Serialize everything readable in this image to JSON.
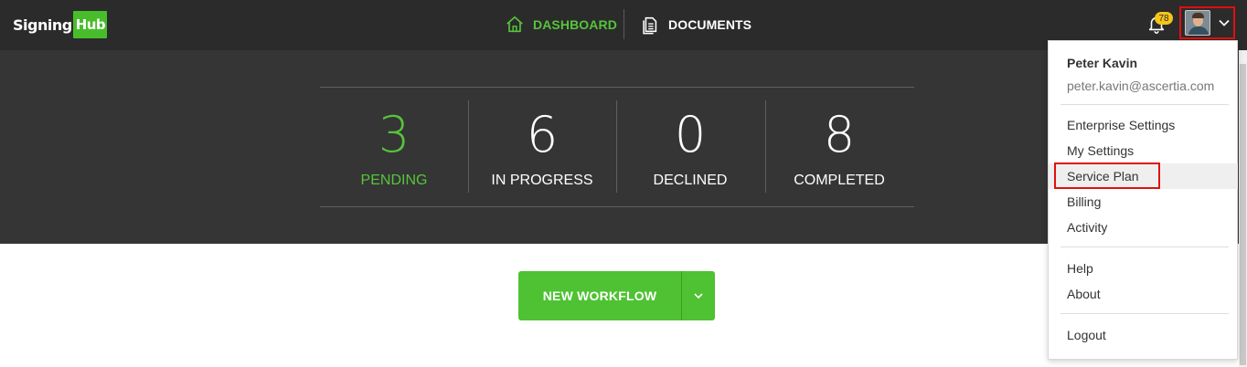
{
  "brand": {
    "logo_text": "Signing",
    "logo_box": "Hub"
  },
  "nav": {
    "dashboard": {
      "label": "DASHBOARD",
      "icon": "home-icon",
      "color": "#56c43a"
    },
    "documents": {
      "label": "DOCUMENTS",
      "icon": "documents-icon",
      "color": "#ffffff"
    }
  },
  "notifications": {
    "count": "78",
    "icon": "bell-icon"
  },
  "user": {
    "avatar_icon": "user-avatar",
    "menu_icon": "chevron-down-icon"
  },
  "stats": [
    {
      "value": "3",
      "label": "PENDING",
      "color": "#56c43a"
    },
    {
      "value": "6",
      "label": "IN PROGRESS",
      "color": "#ffffff"
    },
    {
      "value": "0",
      "label": "DECLINED",
      "color": "#ffffff"
    },
    {
      "value": "8",
      "label": "COMPLETED",
      "color": "#ffffff"
    }
  ],
  "workflow": {
    "label": "NEW WORKFLOW",
    "caret_icon": "chevron-down-icon"
  },
  "account_menu": {
    "name": "Peter Kavin",
    "email": "peter.kavin@ascertia.com",
    "items": [
      "Enterprise Settings",
      "My Settings",
      "Service Plan",
      "Billing",
      "Activity"
    ],
    "support_items": [
      "Help",
      "About"
    ],
    "logout": "Logout",
    "hovered_item": "Service Plan"
  },
  "colors": {
    "topbar": "#2b2b2b",
    "stats_band": "#353535",
    "accent": "#4ec232",
    "highlight": "#e10f0f",
    "badge": "#f5c518"
  }
}
